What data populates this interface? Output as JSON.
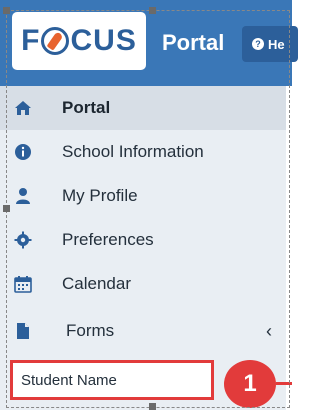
{
  "header": {
    "logo_text": "FOCUS",
    "title": "Portal",
    "help_label": "He",
    "help_icon": "question-circle-icon"
  },
  "sidebar": {
    "items": [
      {
        "label": "Portal",
        "icon": "home-icon",
        "active": true
      },
      {
        "label": "School Information",
        "icon": "info-circle-icon",
        "active": false
      },
      {
        "label": "My Profile",
        "icon": "user-icon",
        "active": false
      },
      {
        "label": "Preferences",
        "icon": "gear-icon",
        "active": false
      },
      {
        "label": "Calendar",
        "icon": "calendar-icon",
        "active": false
      },
      {
        "label": "Forms",
        "icon": "file-icon",
        "active": false
      }
    ]
  },
  "student": {
    "field_value": "Student Name"
  },
  "callout": {
    "number": "1"
  },
  "colors": {
    "header_bg": "#3a77b7",
    "sidebar_bg": "#e9eef3",
    "highlight_red": "#e23b3b"
  }
}
